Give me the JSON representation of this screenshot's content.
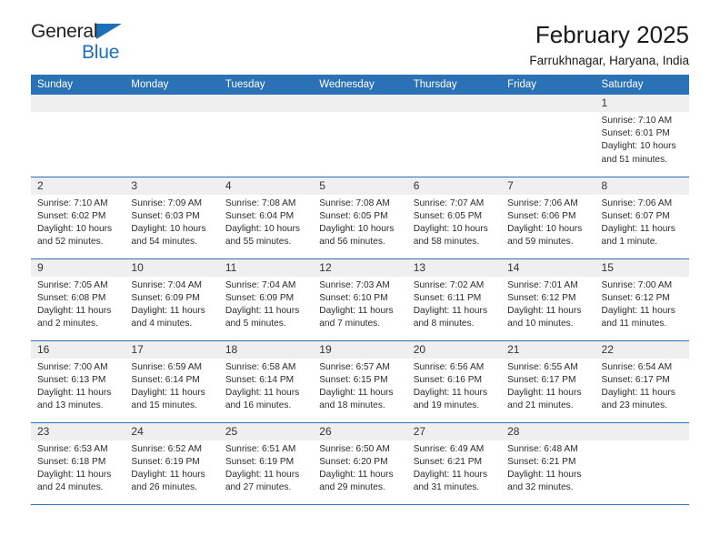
{
  "brand": {
    "name_part1": "General",
    "name_part2": "Blue",
    "accent_color": "#1d70b8"
  },
  "header": {
    "title": "February 2025",
    "subtitle": "Farrukhnagar, Haryana, India"
  },
  "theme": {
    "header_blue": "#2a72b5",
    "daynum_gray": "#efefef"
  },
  "calendar": {
    "weekday_headers": [
      "Sunday",
      "Monday",
      "Tuesday",
      "Wednesday",
      "Thursday",
      "Friday",
      "Saturday"
    ],
    "weeks": [
      [
        {
          "day": "",
          "sunrise": "",
          "sunset": "",
          "daylight": ""
        },
        {
          "day": "",
          "sunrise": "",
          "sunset": "",
          "daylight": ""
        },
        {
          "day": "",
          "sunrise": "",
          "sunset": "",
          "daylight": ""
        },
        {
          "day": "",
          "sunrise": "",
          "sunset": "",
          "daylight": ""
        },
        {
          "day": "",
          "sunrise": "",
          "sunset": "",
          "daylight": ""
        },
        {
          "day": "",
          "sunrise": "",
          "sunset": "",
          "daylight": ""
        },
        {
          "day": "1",
          "sunrise": "Sunrise: 7:10 AM",
          "sunset": "Sunset: 6:01 PM",
          "daylight": "Daylight: 10 hours and 51 minutes."
        }
      ],
      [
        {
          "day": "2",
          "sunrise": "Sunrise: 7:10 AM",
          "sunset": "Sunset: 6:02 PM",
          "daylight": "Daylight: 10 hours and 52 minutes."
        },
        {
          "day": "3",
          "sunrise": "Sunrise: 7:09 AM",
          "sunset": "Sunset: 6:03 PM",
          "daylight": "Daylight: 10 hours and 54 minutes."
        },
        {
          "day": "4",
          "sunrise": "Sunrise: 7:08 AM",
          "sunset": "Sunset: 6:04 PM",
          "daylight": "Daylight: 10 hours and 55 minutes."
        },
        {
          "day": "5",
          "sunrise": "Sunrise: 7:08 AM",
          "sunset": "Sunset: 6:05 PM",
          "daylight": "Daylight: 10 hours and 56 minutes."
        },
        {
          "day": "6",
          "sunrise": "Sunrise: 7:07 AM",
          "sunset": "Sunset: 6:05 PM",
          "daylight": "Daylight: 10 hours and 58 minutes."
        },
        {
          "day": "7",
          "sunrise": "Sunrise: 7:06 AM",
          "sunset": "Sunset: 6:06 PM",
          "daylight": "Daylight: 10 hours and 59 minutes."
        },
        {
          "day": "8",
          "sunrise": "Sunrise: 7:06 AM",
          "sunset": "Sunset: 6:07 PM",
          "daylight": "Daylight: 11 hours and 1 minute."
        }
      ],
      [
        {
          "day": "9",
          "sunrise": "Sunrise: 7:05 AM",
          "sunset": "Sunset: 6:08 PM",
          "daylight": "Daylight: 11 hours and 2 minutes."
        },
        {
          "day": "10",
          "sunrise": "Sunrise: 7:04 AM",
          "sunset": "Sunset: 6:09 PM",
          "daylight": "Daylight: 11 hours and 4 minutes."
        },
        {
          "day": "11",
          "sunrise": "Sunrise: 7:04 AM",
          "sunset": "Sunset: 6:09 PM",
          "daylight": "Daylight: 11 hours and 5 minutes."
        },
        {
          "day": "12",
          "sunrise": "Sunrise: 7:03 AM",
          "sunset": "Sunset: 6:10 PM",
          "daylight": "Daylight: 11 hours and 7 minutes."
        },
        {
          "day": "13",
          "sunrise": "Sunrise: 7:02 AM",
          "sunset": "Sunset: 6:11 PM",
          "daylight": "Daylight: 11 hours and 8 minutes."
        },
        {
          "day": "14",
          "sunrise": "Sunrise: 7:01 AM",
          "sunset": "Sunset: 6:12 PM",
          "daylight": "Daylight: 11 hours and 10 minutes."
        },
        {
          "day": "15",
          "sunrise": "Sunrise: 7:00 AM",
          "sunset": "Sunset: 6:12 PM",
          "daylight": "Daylight: 11 hours and 11 minutes."
        }
      ],
      [
        {
          "day": "16",
          "sunrise": "Sunrise: 7:00 AM",
          "sunset": "Sunset: 6:13 PM",
          "daylight": "Daylight: 11 hours and 13 minutes."
        },
        {
          "day": "17",
          "sunrise": "Sunrise: 6:59 AM",
          "sunset": "Sunset: 6:14 PM",
          "daylight": "Daylight: 11 hours and 15 minutes."
        },
        {
          "day": "18",
          "sunrise": "Sunrise: 6:58 AM",
          "sunset": "Sunset: 6:14 PM",
          "daylight": "Daylight: 11 hours and 16 minutes."
        },
        {
          "day": "19",
          "sunrise": "Sunrise: 6:57 AM",
          "sunset": "Sunset: 6:15 PM",
          "daylight": "Daylight: 11 hours and 18 minutes."
        },
        {
          "day": "20",
          "sunrise": "Sunrise: 6:56 AM",
          "sunset": "Sunset: 6:16 PM",
          "daylight": "Daylight: 11 hours and 19 minutes."
        },
        {
          "day": "21",
          "sunrise": "Sunrise: 6:55 AM",
          "sunset": "Sunset: 6:17 PM",
          "daylight": "Daylight: 11 hours and 21 minutes."
        },
        {
          "day": "22",
          "sunrise": "Sunrise: 6:54 AM",
          "sunset": "Sunset: 6:17 PM",
          "daylight": "Daylight: 11 hours and 23 minutes."
        }
      ],
      [
        {
          "day": "23",
          "sunrise": "Sunrise: 6:53 AM",
          "sunset": "Sunset: 6:18 PM",
          "daylight": "Daylight: 11 hours and 24 minutes."
        },
        {
          "day": "24",
          "sunrise": "Sunrise: 6:52 AM",
          "sunset": "Sunset: 6:19 PM",
          "daylight": "Daylight: 11 hours and 26 minutes."
        },
        {
          "day": "25",
          "sunrise": "Sunrise: 6:51 AM",
          "sunset": "Sunset: 6:19 PM",
          "daylight": "Daylight: 11 hours and 27 minutes."
        },
        {
          "day": "26",
          "sunrise": "Sunrise: 6:50 AM",
          "sunset": "Sunset: 6:20 PM",
          "daylight": "Daylight: 11 hours and 29 minutes."
        },
        {
          "day": "27",
          "sunrise": "Sunrise: 6:49 AM",
          "sunset": "Sunset: 6:21 PM",
          "daylight": "Daylight: 11 hours and 31 minutes."
        },
        {
          "day": "28",
          "sunrise": "Sunrise: 6:48 AM",
          "sunset": "Sunset: 6:21 PM",
          "daylight": "Daylight: 11 hours and 32 minutes."
        },
        {
          "day": "",
          "sunrise": "",
          "sunset": "",
          "daylight": ""
        }
      ]
    ]
  }
}
